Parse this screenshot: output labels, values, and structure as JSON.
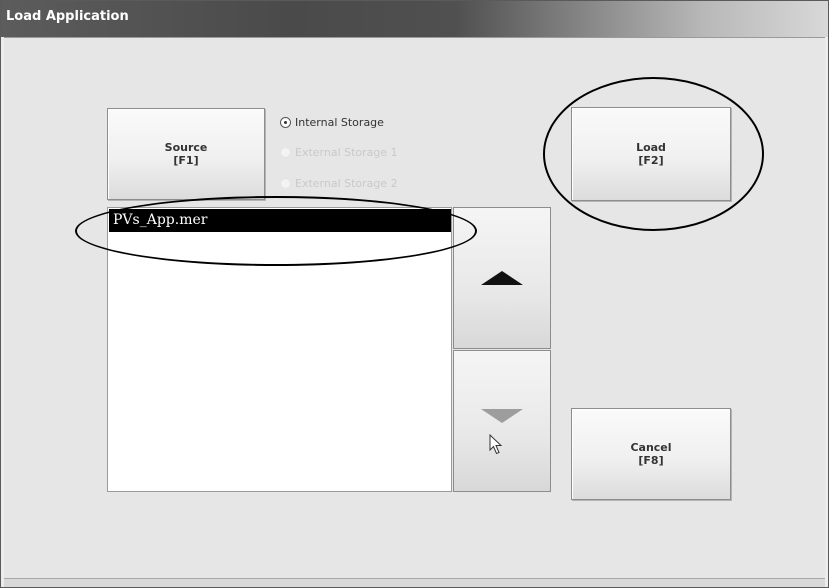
{
  "window": {
    "title": "Load Application"
  },
  "source_button": {
    "label": "Source",
    "key": "[F1]"
  },
  "storage_options": [
    {
      "label": "Internal Storage",
      "selected": true,
      "enabled": true
    },
    {
      "label": "External Storage 1",
      "selected": false,
      "enabled": false
    },
    {
      "label": "External Storage 2",
      "selected": false,
      "enabled": false
    }
  ],
  "file_list": {
    "items": [
      "PVs_App.mer"
    ],
    "selected_index": 0
  },
  "load_button": {
    "label": "Load",
    "key": "[F2]"
  },
  "cancel_button": {
    "label": "Cancel",
    "key": "[F8]"
  },
  "scroll": {
    "up_icon": "triangle-up-icon",
    "down_icon": "triangle-down-icon"
  },
  "annotations": {
    "color": "#000000"
  },
  "colors": {
    "selection_bg": "#000000",
    "selection_text": "#ffffff",
    "client_bg": "#e6e6e6"
  }
}
